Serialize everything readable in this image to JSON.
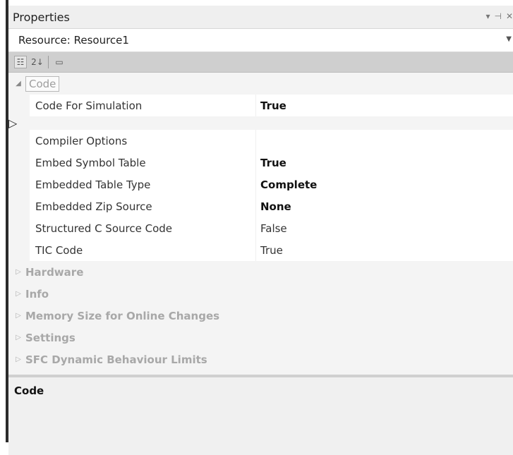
{
  "window": {
    "title": "Properties",
    "title_icons": [
      "▾",
      "⊣",
      "✕"
    ]
  },
  "resource_selector": {
    "value": "Resource: Resource1",
    "dropdown_icon": "chevron-down-icon"
  },
  "toolbar": {
    "buttons": [
      {
        "name": "categorized-icon",
        "glyph": "☷",
        "active": true
      },
      {
        "name": "alphabetical-icon",
        "glyph": "2↓",
        "active": false
      },
      {
        "name": "property-pages-icon",
        "glyph": "▭",
        "active": false
      }
    ]
  },
  "grid": {
    "expanded_category": "Code",
    "properties": [
      {
        "name": "Code For Simulation",
        "value": "True",
        "bold": true,
        "expandable": false
      },
      {
        "name": "Compiler Options",
        "value": "",
        "bold": false,
        "expandable": true
      },
      {
        "name": "Embed Symbol Table",
        "value": "True",
        "bold": true,
        "expandable": false
      },
      {
        "name": "Embedded Table Type",
        "value": "Complete",
        "bold": true,
        "expandable": false
      },
      {
        "name": "Embedded Zip Source",
        "value": "None",
        "bold": true,
        "expandable": false
      },
      {
        "name": "Structured C Source Code",
        "value": "False",
        "bold": false,
        "expandable": false
      },
      {
        "name": "TIC Code",
        "value": "True",
        "bold": false,
        "expandable": false
      }
    ],
    "collapsed_categories": [
      "Hardware",
      "Info",
      "Memory Size for Online Changes",
      "Settings",
      "SFC Dynamic Behaviour Limits"
    ]
  },
  "description": {
    "title": "Code"
  }
}
